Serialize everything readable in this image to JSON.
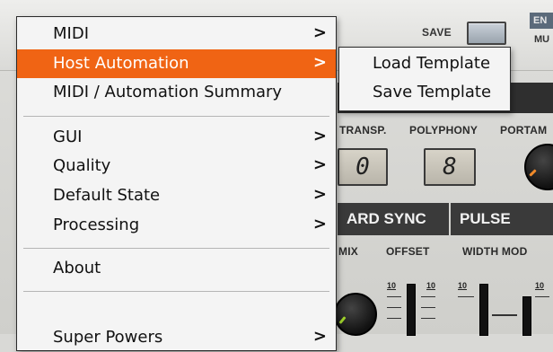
{
  "background": {
    "save_label": "SAVE",
    "en_tag": "EN",
    "mu_tag": "MU",
    "transp_label": "TRANSP.",
    "polyphony_label": "POLYPHONY",
    "portamento_label": "PORTAM",
    "transp_value": "0",
    "polyphony_value": "8",
    "hard_sync_label": "ARD SYNC",
    "pulse_label": "PULSE",
    "mix_label": "MIX",
    "offset_label": "OFFSET",
    "width_mod_label": "WIDTH MOD",
    "tick_10_a": "10",
    "tick_10_b": "10",
    "tick_10_c": "10",
    "tick_10_d": "10"
  },
  "menu": {
    "items": [
      {
        "label": "MIDI",
        "has_submenu": true
      },
      {
        "label": "Host Automation",
        "has_submenu": true,
        "active": true
      },
      {
        "label": "MIDI / Automation Summary",
        "has_submenu": false
      },
      {
        "label": "GUI",
        "has_submenu": true
      },
      {
        "label": "Quality",
        "has_submenu": true
      },
      {
        "label": "Default State",
        "has_submenu": true
      },
      {
        "label": "Processing",
        "has_submenu": true
      },
      {
        "label": "About",
        "has_submenu": false
      },
      {
        "label": "Super Powers",
        "has_submenu": true
      }
    ],
    "chevron": ">"
  },
  "submenu": {
    "items": [
      {
        "label": "Load Template"
      },
      {
        "label": "Save Template"
      }
    ]
  },
  "colors": {
    "highlight": "#f06414",
    "menu_bg": "#f4f4f4",
    "panel_dark": "#3a3a3a"
  }
}
